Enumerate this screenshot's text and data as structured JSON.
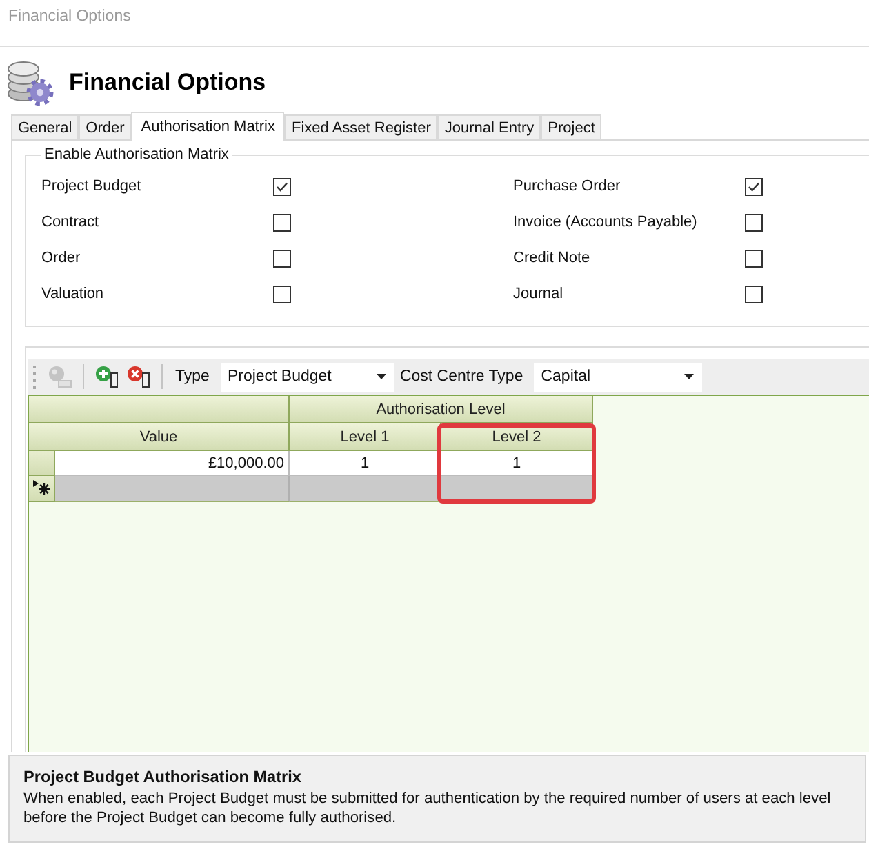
{
  "window": {
    "title": "Financial Options"
  },
  "header": {
    "title": "Financial Options"
  },
  "tabs": [
    {
      "label": "General",
      "selected": false
    },
    {
      "label": "Order",
      "selected": false
    },
    {
      "label": "Authorisation Matrix",
      "selected": true
    },
    {
      "label": "Fixed Asset Register",
      "selected": false
    },
    {
      "label": "Journal Entry",
      "selected": false
    },
    {
      "label": "Project",
      "selected": false
    }
  ],
  "enable_matrix": {
    "title": "Enable Authorisation Matrix",
    "columns": [
      {
        "items": [
          {
            "label": "Project Budget",
            "checked": true
          },
          {
            "label": "Contract",
            "checked": false
          },
          {
            "label": "Order",
            "checked": false
          },
          {
            "label": "Valuation",
            "checked": false
          }
        ]
      },
      {
        "items": [
          {
            "label": "Purchase Order",
            "checked": true
          },
          {
            "label": "Invoice (Accounts Payable)",
            "checked": false
          },
          {
            "label": "Credit Note",
            "checked": false
          },
          {
            "label": "Journal",
            "checked": false
          }
        ]
      }
    ]
  },
  "toolbar": {
    "buttons": [
      {
        "kind": "pin",
        "disabled": true
      },
      {
        "kind": "add",
        "disabled": false
      },
      {
        "kind": "remove",
        "disabled": false
      }
    ],
    "filters": [
      {
        "label": "Type",
        "value": "Project Budget"
      },
      {
        "label": "Cost Centre Type",
        "value": "Capital"
      }
    ]
  },
  "grid": {
    "column_groups": [
      {
        "columns": [
          {
            "header": "Value",
            "highlighted": false
          }
        ]
      },
      {
        "label": "Authorisation Level",
        "columns": [
          {
            "header": "Level 1",
            "highlighted": false
          },
          {
            "header": "Level 2",
            "highlighted": true
          }
        ]
      }
    ],
    "rows": [
      {
        "cells": [
          "£10,000.00",
          "1",
          "1"
        ]
      }
    ]
  },
  "description": {
    "title": "Project Budget Authorisation Matrix",
    "text": "When enabled, each Project Budget must be submitted for authentication by the required number of users at each level before the Project Budget can become fully authorised."
  }
}
